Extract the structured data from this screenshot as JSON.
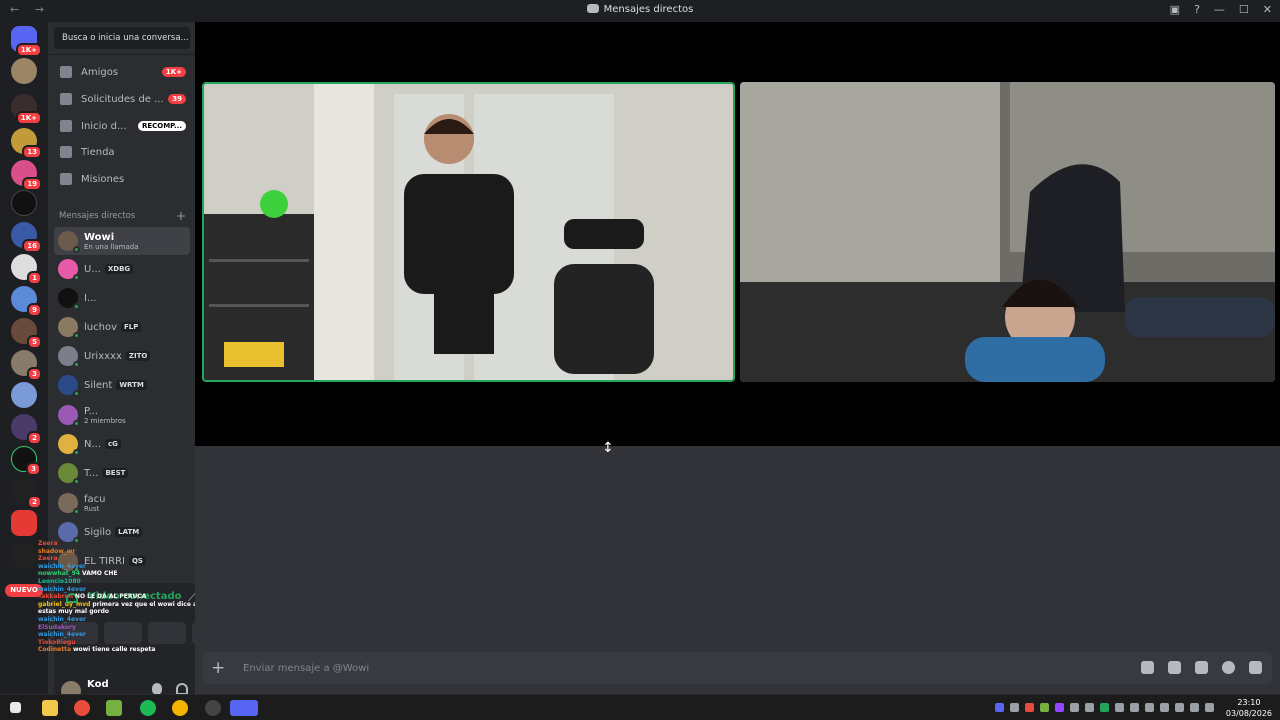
{
  "window": {
    "title": "Mensajes directos",
    "nav": "← →",
    "controls": [
      "▣",
      "?",
      "—",
      "☐",
      "✕"
    ]
  },
  "servers": {
    "badges": [
      "1K+",
      "1K+",
      "13",
      "19",
      "16",
      "1",
      "9",
      "5",
      "3",
      "2",
      "3",
      "2"
    ],
    "new_label": "NUEVO"
  },
  "sidebar": {
    "search_placeholder": "Busca o inicia una conversa...",
    "nav": [
      {
        "label": "Amigos",
        "badge": "1K+"
      },
      {
        "label": "Solicitudes de ...",
        "badge": "39"
      },
      {
        "label": "Inicio d...",
        "badge": "RECOMP..."
      },
      {
        "label": "Tienda",
        "badge": ""
      },
      {
        "label": "Misiones",
        "badge": ""
      }
    ],
    "dm_header": "Mensajes directos",
    "dm_add": "+",
    "dms": [
      {
        "name": "Wowi",
        "sub": "En una llamada",
        "tag": "",
        "color": "#6d5a4b"
      },
      {
        "name": "U...",
        "sub": "",
        "tag": "XDBG",
        "color": "#e85aa8"
      },
      {
        "name": "I...",
        "sub": "",
        "tag": "",
        "color": "#111111"
      },
      {
        "name": "luchov",
        "sub": "",
        "tag": "FLP",
        "color": "#8a7a62"
      },
      {
        "name": "Urixxxx",
        "sub": "",
        "tag": "ZITO",
        "color": "#7a7f8a"
      },
      {
        "name": "Silent",
        "sub": "",
        "tag": "WRTM",
        "color": "#2a4a8a"
      },
      {
        "name": "P...",
        "sub": "2 miembros",
        "tag": "",
        "color": "#9b59b6"
      },
      {
        "name": "N...",
        "sub": "",
        "tag": "cG",
        "color": "#e0b040"
      },
      {
        "name": "T...",
        "sub": "",
        "tag": "BEST",
        "color": "#6a8a3a"
      },
      {
        "name": "facu",
        "sub": "Rust",
        "tag": "",
        "color": "#7a6a5a"
      },
      {
        "name": "Sigilo",
        "sub": "",
        "tag": "LATM",
        "color": "#5a6aaa"
      },
      {
        "name": "EL TIRRI",
        "sub": "",
        "tag": "QS",
        "color": "#6a5a4a"
      }
    ]
  },
  "voice_panel": {
    "status": "Video conectado"
  },
  "user_panel": {
    "name": "Kod"
  },
  "chat_overlay": [
    {
      "user": "Zeera",
      "msg": "",
      "color": "#e74c3c"
    },
    {
      "user": "shadow_wr",
      "msg": "",
      "color": "#e67e22"
    },
    {
      "user": "Zeera",
      "msg": "",
      "color": "#e74c3c"
    },
    {
      "user": "waichin_4ever",
      "msg": "",
      "color": "#3498db"
    },
    {
      "user": "nowwhat_94",
      "msg": "VAMO CHE",
      "color": "#2ecc71"
    },
    {
      "user": "Leoncio1080",
      "msg": "",
      "color": "#1abc9c"
    },
    {
      "user": "waichin_4ever",
      "msg": "",
      "color": "#3498db"
    },
    {
      "user": "Takkabren",
      "msg": "NO LE DA AL PERUCA",
      "color": "#e74c3c"
    },
    {
      "user": "gabriel_uy_mvd",
      "msg": "primera vez que el wowi dice algo coherente...",
      "color": "#f1c40f"
    },
    {
      "user": "",
      "msg": "estas muy mal gordo",
      "color": "#ffffff"
    },
    {
      "user": "waichin_4ever",
      "msg": "",
      "color": "#3498db"
    },
    {
      "user": "ElSudakory",
      "msg": "",
      "color": "#9b59b6"
    },
    {
      "user": "waichin_4ever",
      "msg": "",
      "color": "#3498db"
    },
    {
      "user": "TiokoBiegu",
      "msg": "",
      "color": "#e74c3c"
    },
    {
      "user": "Codinetta",
      "msg": "wowi tiene calle respeta",
      "color": "#e67e22"
    }
  ],
  "composer": {
    "placeholder": "Enviar mensaje a @Wowi",
    "add": "+"
  },
  "clock": {
    "time": "23:10",
    "date": "03/08/2026"
  }
}
